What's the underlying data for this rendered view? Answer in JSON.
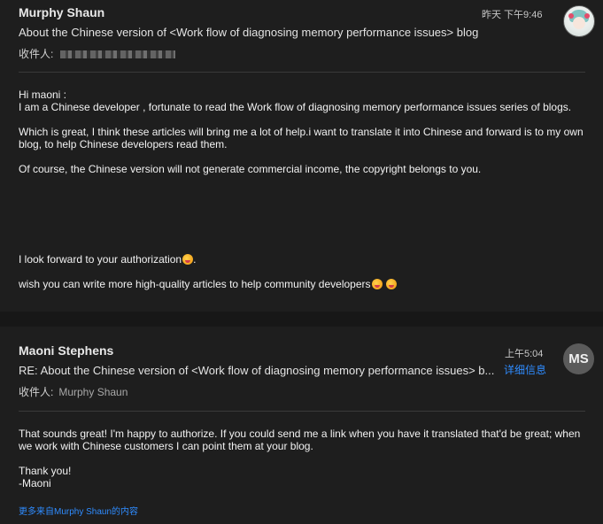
{
  "message1": {
    "sender": "Murphy Shaun",
    "time": "昨天 下午9:46",
    "subject": "About the Chinese version of <Work flow of diagnosing memory performance issues> blog",
    "recipient_label": "收件人:",
    "body": {
      "greeting": "Hi maoni :",
      "line1": "I am a Chinese developer , fortunate to read the Work flow of diagnosing memory performance issues series of blogs.",
      "para2": "Which is great, I think these articles will bring me a lot of help.i want to translate it into Chinese and forward is to my own blog, to help Chinese developers read them.",
      "para3": "Of course, the Chinese version will not generate commercial income, the copyright belongs to you.",
      "para4": "I look forward to your authorization",
      "para4_end": ".",
      "para5": "wish you can write more high-quality articles to help community developers"
    }
  },
  "message2": {
    "sender": "Maoni Stephens",
    "time": "上午5:04",
    "details_link": "详细信息",
    "avatar_initials": "MS",
    "subject": "RE: About the Chinese version of <Work flow of diagnosing memory performance issues> b...",
    "recipient_label": "收件人:",
    "recipient": "Murphy Shaun",
    "body": {
      "para1": "That sounds great! I'm happy to authorize. If you could send me a link when you have it translated that'd be great; when we work with Chinese customers I can point them at your blog.",
      "thanks": "Thank you!",
      "signature": "-Maoni"
    },
    "more_link": "更多来自Murphy Shaun的内容"
  },
  "colors": {
    "background": "#1e1e1e",
    "link": "#2f8cff",
    "avatar_bg": "#5b5b5b"
  },
  "icons": [
    "avatar-image",
    "laughing-emoji"
  ]
}
